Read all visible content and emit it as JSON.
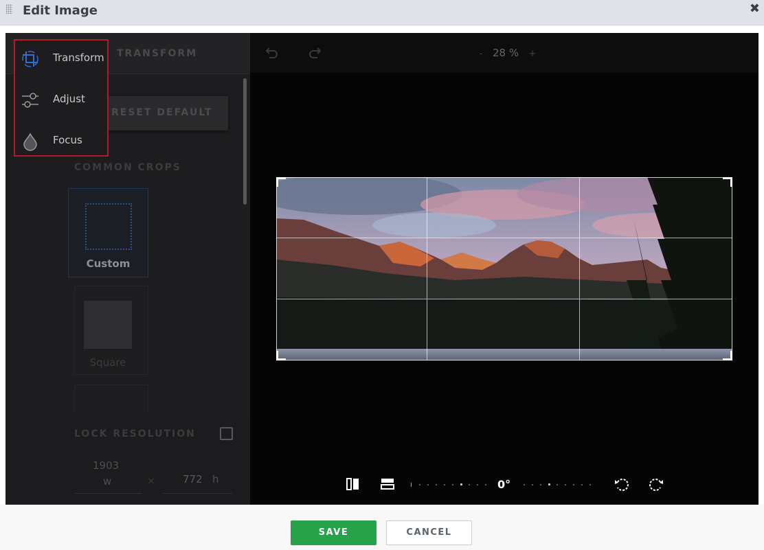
{
  "titlebar": {
    "title": "Edit Image",
    "close_symbol": "✖"
  },
  "panel": {
    "heading": "TRANSFORM",
    "reset_label": "RESET DEFAULT",
    "common_crops_label": "COMMON CROPS",
    "crops": [
      {
        "label": "Custom",
        "selected": true
      },
      {
        "label": "Square",
        "selected": false
      }
    ],
    "lock_resolution_label": "LOCK RESOLUTION",
    "lock_resolution_checked": false,
    "width_value": "1903",
    "width_unit": "w",
    "times_symbol": "×",
    "height_value": "772",
    "height_unit": "h"
  },
  "menu": {
    "items": [
      {
        "label": "Transform",
        "icon": "crop-transform-icon"
      },
      {
        "label": "Adjust",
        "icon": "sliders-icon"
      },
      {
        "label": "Focus",
        "icon": "drop-icon"
      }
    ]
  },
  "viewport": {
    "zoom_minus": "-",
    "zoom_value": "28 %",
    "zoom_plus": "+",
    "rotation_value": "0°"
  },
  "footer": {
    "save_label": "SAVE",
    "cancel_label": "CANCEL"
  },
  "colors": {
    "accent": "#27a24a",
    "highlight": "#b3192d",
    "icon_active": "#2f6fd6"
  }
}
